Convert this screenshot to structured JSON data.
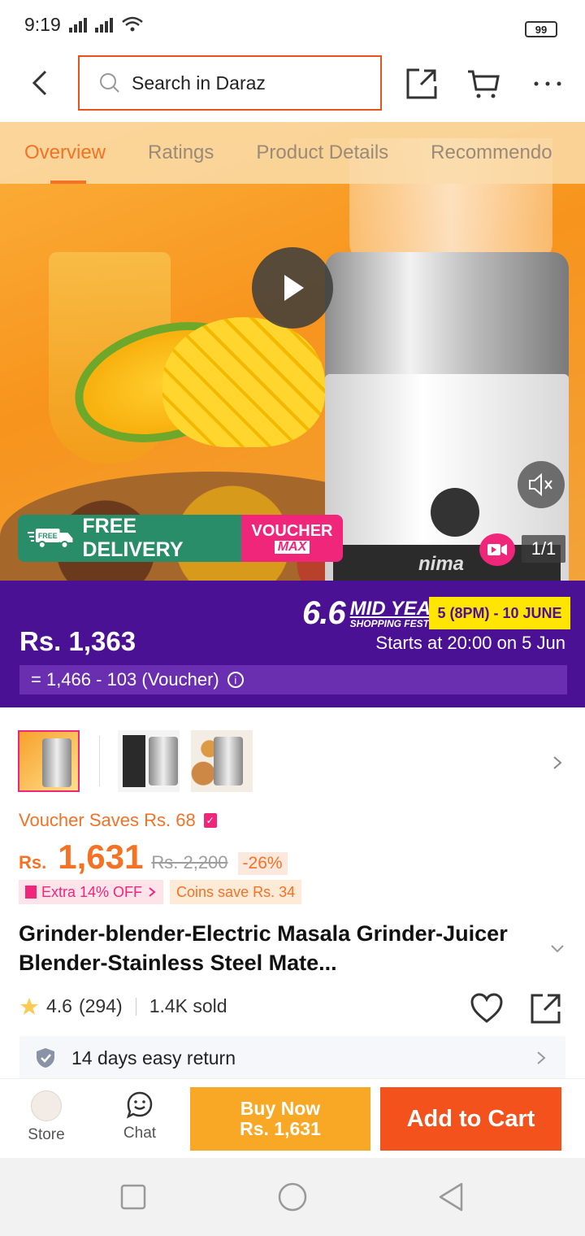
{
  "status_bar": {
    "time": "9:19",
    "battery": "99"
  },
  "header": {
    "search_placeholder": "Search in Daraz"
  },
  "tabs": [
    {
      "label": "Overview",
      "active": true
    },
    {
      "label": "Ratings",
      "active": false
    },
    {
      "label": "Product Details",
      "active": false
    },
    {
      "label": "Recommendo",
      "active": false
    }
  ],
  "hero": {
    "brand_text": "nima",
    "image_counter": "1/1",
    "free_delivery_badge": "FREE",
    "free_delivery_label": "FREE DELIVERY",
    "voucher_label": "VOUCHER",
    "voucher_max": "MAX"
  },
  "campaign": {
    "price": "Rs. 1,363",
    "logo_number": "6.6",
    "logo_title": "MID YEAR",
    "logo_subtitle": "SHOPPING FEST!",
    "date_range": "5 (8PM) - 10 JUNE",
    "starts_text": "Starts at 20:00 on 5 Jun",
    "breakdown": "= 1,466 - 103 (Voucher)"
  },
  "product": {
    "voucher_saves": "Voucher Saves Rs. 68",
    "currency": "Rs.",
    "price": "1,631",
    "original_price": "Rs. 2,200",
    "discount": "-26%",
    "extra_off": "Extra 14% OFF",
    "coins_save": "Coins save Rs. 34",
    "title": "Grinder-blender-Electric Masala Grinder-Juicer Blender-Stainless Steel Mate...",
    "rating": "4.6",
    "rating_count": "(294)",
    "sold": "1.4K sold",
    "return_policy": "14 days easy return"
  },
  "bottom_bar": {
    "store_label": "Store",
    "chat_label": "Chat",
    "buy_now_label": "Buy Now",
    "buy_now_price": "Rs. 1,631",
    "add_to_cart_label": "Add to Cart"
  },
  "colors": {
    "accent_orange": "#f57224",
    "campaign_purple": "#4b1194",
    "buy_now": "#f9a825",
    "add_to_cart": "#f3521c",
    "voucher_pink": "#f0267b",
    "delivery_green": "#2a8d69"
  },
  "icons": [
    "back-icon",
    "search-icon",
    "share-icon",
    "cart-icon",
    "more-icon",
    "play-icon",
    "mute-icon",
    "video-icon",
    "info-icon",
    "star-icon",
    "heart-icon",
    "shield-icon",
    "chat-icon"
  ]
}
